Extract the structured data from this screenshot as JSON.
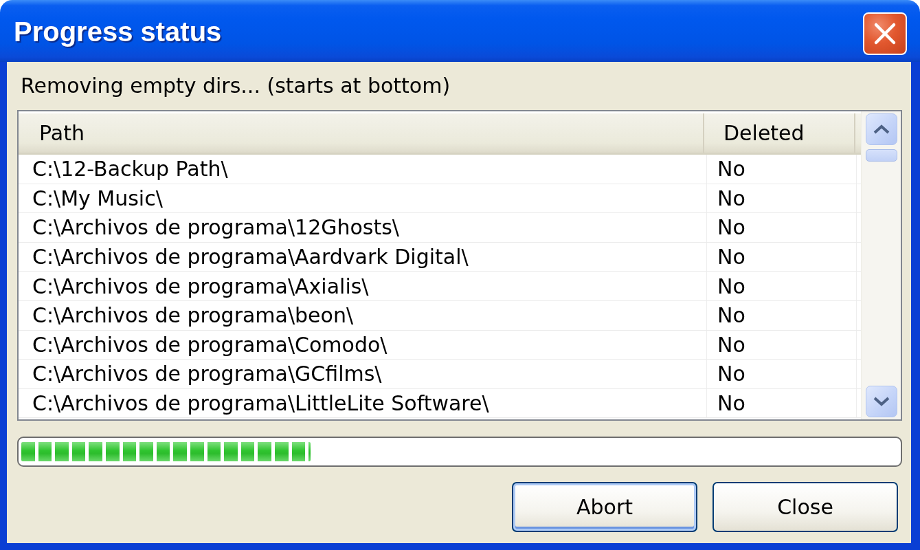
{
  "window": {
    "title": "Progress status"
  },
  "status_text": "Removing empty dirs... (starts at bottom)",
  "table": {
    "columns": [
      "Path",
      "Deleted"
    ],
    "rows": [
      {
        "path": "C:\\12-Backup Path\\",
        "deleted": "No"
      },
      {
        "path": "C:\\My Music\\",
        "deleted": "No"
      },
      {
        "path": "C:\\Archivos de programa\\12Ghosts\\",
        "deleted": "No"
      },
      {
        "path": "C:\\Archivos de programa\\Aardvark Digital\\",
        "deleted": "No"
      },
      {
        "path": "C:\\Archivos de programa\\Axialis\\",
        "deleted": "No"
      },
      {
        "path": "C:\\Archivos de programa\\beon\\",
        "deleted": "No"
      },
      {
        "path": "C:\\Archivos de programa\\Comodo\\",
        "deleted": "No"
      },
      {
        "path": "C:\\Archivos de programa\\GCfilms\\",
        "deleted": "No"
      },
      {
        "path": "C:\\Archivos de programa\\LittleLite Software\\",
        "deleted": "No"
      }
    ]
  },
  "progress": {
    "level": 0.33
  },
  "buttons": [
    {
      "label": "Abort",
      "default": true
    },
    {
      "label": "Close",
      "default": false
    }
  ]
}
